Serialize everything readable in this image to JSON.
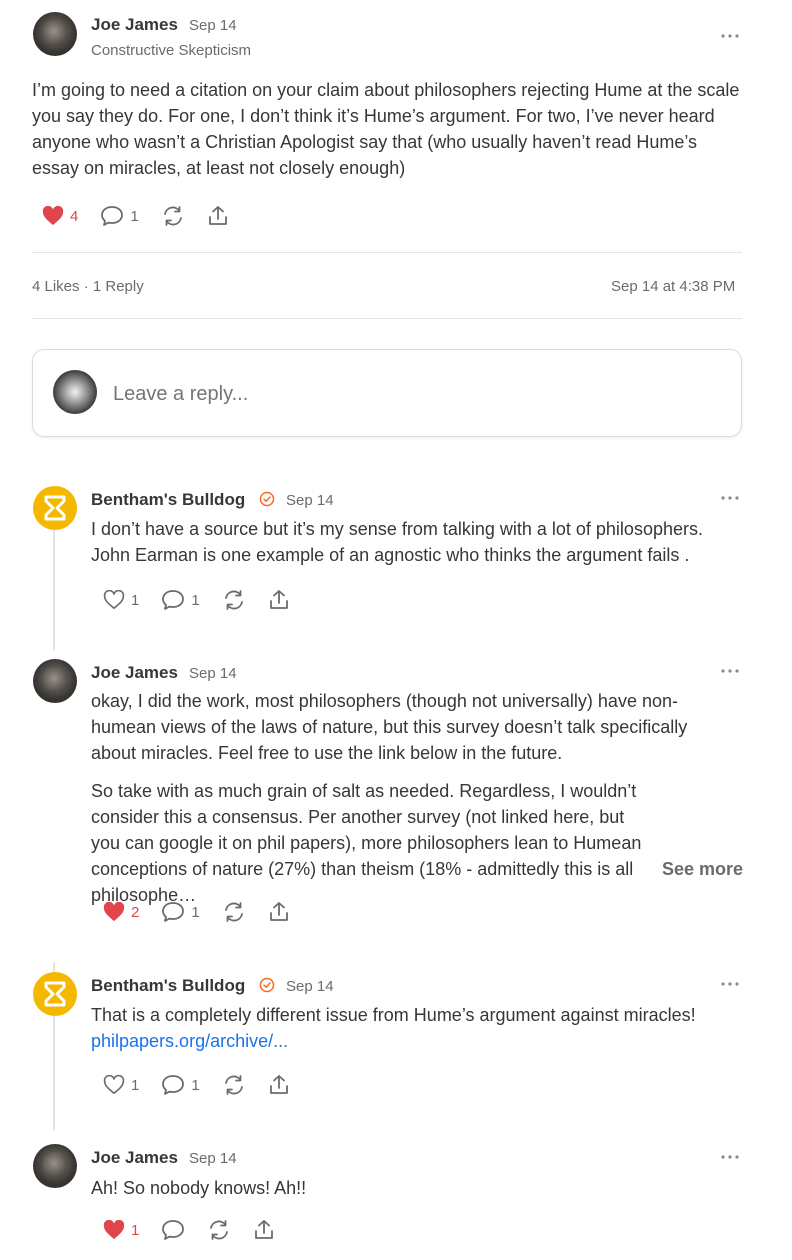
{
  "main_comment": {
    "author": "Joe James",
    "date": "Sep 14",
    "publication": "Constructive Skepticism",
    "text": "I’m going to need a citation on your claim about philosophers rejecting Hume at the scale you say they do. For one, I don’t think it’s Hume’s argument. For two, I’ve never heard anyone who wasn’t a Christian Apologist say that (who usually haven’t read Hume’s essay on miracles, at least not closely enough)",
    "likes": "4",
    "replies": "1",
    "stats": "4 Likes · 1 Reply",
    "timestamp": "Sep 14 at 4:38 PM"
  },
  "reply_box": {
    "placeholder": "Leave a reply..."
  },
  "replies": [
    {
      "author": "Bentham's Bulldog",
      "date": "Sep 14",
      "text": "I don’t have a source but it’s my sense from talking with a lot of philosophers. John Earman is one example of an agnostic who thinks the argument fails .",
      "likes": "1",
      "replies": "1"
    },
    {
      "author": "Joe James",
      "date": "Sep 14",
      "text": "okay, I did the work, most philosophers (though not universally) have non-humean views of the laws of nature, but this survey doesn’t talk specifically about miracles. Feel free to use the link below in the future.",
      "text2": "So take with as much grain of salt as needed. Regardless, I wouldn’t consider this a consensus. Per another survey (not linked here, but you can google it on phil papers), more philosophers lean to Humean conceptions of nature (27%) than theism (18% - admittedly this is all philosophe…",
      "see_more": "See more",
      "likes": "2",
      "replies": "1"
    },
    {
      "author": "Bentham's Bulldog",
      "date": "Sep 14",
      "text": "That is a completely different issue from Hume’s argument against miracles!",
      "link": "philpapers.org/archive/...",
      "likes": "1",
      "replies": "1"
    },
    {
      "author": "Joe James",
      "date": "Sep 14",
      "text": "Ah! So nobody knows! Ah!!",
      "likes": "1"
    }
  ],
  "colors": {
    "like_red": "#e0454b",
    "link_blue": "#1a73e8",
    "bulldog_yellow": "#f5b800",
    "verified_orange": "#ff6719"
  }
}
